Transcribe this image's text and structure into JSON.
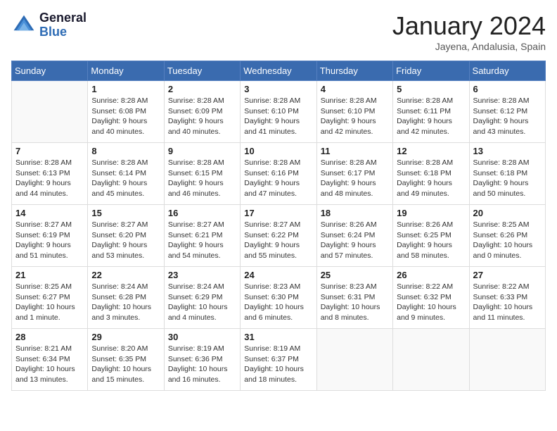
{
  "header": {
    "logo_line1": "General",
    "logo_line2": "Blue",
    "month": "January 2024",
    "location": "Jayena, Andalusia, Spain"
  },
  "days_of_week": [
    "Sunday",
    "Monday",
    "Tuesday",
    "Wednesday",
    "Thursday",
    "Friday",
    "Saturday"
  ],
  "weeks": [
    [
      {
        "day": "",
        "sunrise": "",
        "sunset": "",
        "daylight": ""
      },
      {
        "day": "1",
        "sunrise": "8:28 AM",
        "sunset": "6:08 PM",
        "daylight": "9 hours and 40 minutes."
      },
      {
        "day": "2",
        "sunrise": "8:28 AM",
        "sunset": "6:09 PM",
        "daylight": "9 hours and 40 minutes."
      },
      {
        "day": "3",
        "sunrise": "8:28 AM",
        "sunset": "6:10 PM",
        "daylight": "9 hours and 41 minutes."
      },
      {
        "day": "4",
        "sunrise": "8:28 AM",
        "sunset": "6:10 PM",
        "daylight": "9 hours and 42 minutes."
      },
      {
        "day": "5",
        "sunrise": "8:28 AM",
        "sunset": "6:11 PM",
        "daylight": "9 hours and 42 minutes."
      },
      {
        "day": "6",
        "sunrise": "8:28 AM",
        "sunset": "6:12 PM",
        "daylight": "9 hours and 43 minutes."
      }
    ],
    [
      {
        "day": "7",
        "sunrise": "8:28 AM",
        "sunset": "6:13 PM",
        "daylight": "9 hours and 44 minutes."
      },
      {
        "day": "8",
        "sunrise": "8:28 AM",
        "sunset": "6:14 PM",
        "daylight": "9 hours and 45 minutes."
      },
      {
        "day": "9",
        "sunrise": "8:28 AM",
        "sunset": "6:15 PM",
        "daylight": "9 hours and 46 minutes."
      },
      {
        "day": "10",
        "sunrise": "8:28 AM",
        "sunset": "6:16 PM",
        "daylight": "9 hours and 47 minutes."
      },
      {
        "day": "11",
        "sunrise": "8:28 AM",
        "sunset": "6:17 PM",
        "daylight": "9 hours and 48 minutes."
      },
      {
        "day": "12",
        "sunrise": "8:28 AM",
        "sunset": "6:18 PM",
        "daylight": "9 hours and 49 minutes."
      },
      {
        "day": "13",
        "sunrise": "8:28 AM",
        "sunset": "6:18 PM",
        "daylight": "9 hours and 50 minutes."
      }
    ],
    [
      {
        "day": "14",
        "sunrise": "8:27 AM",
        "sunset": "6:19 PM",
        "daylight": "9 hours and 51 minutes."
      },
      {
        "day": "15",
        "sunrise": "8:27 AM",
        "sunset": "6:20 PM",
        "daylight": "9 hours and 53 minutes."
      },
      {
        "day": "16",
        "sunrise": "8:27 AM",
        "sunset": "6:21 PM",
        "daylight": "9 hours and 54 minutes."
      },
      {
        "day": "17",
        "sunrise": "8:27 AM",
        "sunset": "6:22 PM",
        "daylight": "9 hours and 55 minutes."
      },
      {
        "day": "18",
        "sunrise": "8:26 AM",
        "sunset": "6:24 PM",
        "daylight": "9 hours and 57 minutes."
      },
      {
        "day": "19",
        "sunrise": "8:26 AM",
        "sunset": "6:25 PM",
        "daylight": "9 hours and 58 minutes."
      },
      {
        "day": "20",
        "sunrise": "8:25 AM",
        "sunset": "6:26 PM",
        "daylight": "10 hours and 0 minutes."
      }
    ],
    [
      {
        "day": "21",
        "sunrise": "8:25 AM",
        "sunset": "6:27 PM",
        "daylight": "10 hours and 1 minute."
      },
      {
        "day": "22",
        "sunrise": "8:24 AM",
        "sunset": "6:28 PM",
        "daylight": "10 hours and 3 minutes."
      },
      {
        "day": "23",
        "sunrise": "8:24 AM",
        "sunset": "6:29 PM",
        "daylight": "10 hours and 4 minutes."
      },
      {
        "day": "24",
        "sunrise": "8:23 AM",
        "sunset": "6:30 PM",
        "daylight": "10 hours and 6 minutes."
      },
      {
        "day": "25",
        "sunrise": "8:23 AM",
        "sunset": "6:31 PM",
        "daylight": "10 hours and 8 minutes."
      },
      {
        "day": "26",
        "sunrise": "8:22 AM",
        "sunset": "6:32 PM",
        "daylight": "10 hours and 9 minutes."
      },
      {
        "day": "27",
        "sunrise": "8:22 AM",
        "sunset": "6:33 PM",
        "daylight": "10 hours and 11 minutes."
      }
    ],
    [
      {
        "day": "28",
        "sunrise": "8:21 AM",
        "sunset": "6:34 PM",
        "daylight": "10 hours and 13 minutes."
      },
      {
        "day": "29",
        "sunrise": "8:20 AM",
        "sunset": "6:35 PM",
        "daylight": "10 hours and 15 minutes."
      },
      {
        "day": "30",
        "sunrise": "8:19 AM",
        "sunset": "6:36 PM",
        "daylight": "10 hours and 16 minutes."
      },
      {
        "day": "31",
        "sunrise": "8:19 AM",
        "sunset": "6:37 PM",
        "daylight": "10 hours and 18 minutes."
      },
      {
        "day": "",
        "sunrise": "",
        "sunset": "",
        "daylight": ""
      },
      {
        "day": "",
        "sunrise": "",
        "sunset": "",
        "daylight": ""
      },
      {
        "day": "",
        "sunrise": "",
        "sunset": "",
        "daylight": ""
      }
    ]
  ]
}
